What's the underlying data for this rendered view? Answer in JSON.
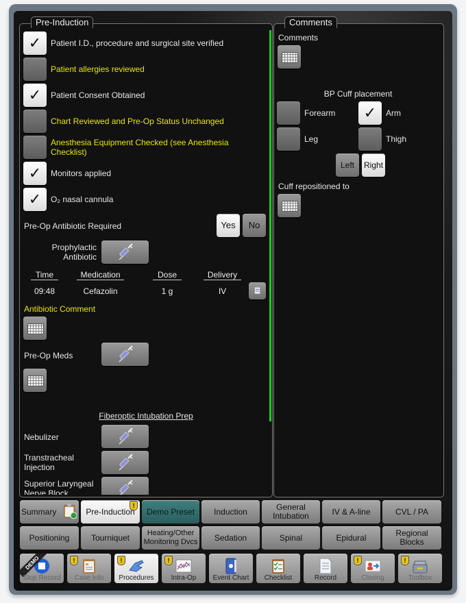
{
  "pre_induction": {
    "title": "Pre-Induction",
    "checklist": [
      {
        "label": "Patient I.D., procedure and surgical site verified",
        "checked": true,
        "highlight": false
      },
      {
        "label": "Patient allergies reviewed",
        "checked": false,
        "highlight": true
      },
      {
        "label": "Patient Consent Obtained",
        "checked": true,
        "highlight": false
      },
      {
        "label": "Chart Reviewed and Pre-Op Status Unchanged",
        "checked": false,
        "highlight": true
      },
      {
        "label": "Anesthesia Equipment Checked (see Anesthesia Checklist)",
        "checked": false,
        "highlight": true
      },
      {
        "label": "Monitors applied",
        "checked": true,
        "highlight": false
      },
      {
        "label": "O₂ nasal cannula",
        "checked": true,
        "highlight": false
      }
    ],
    "check_mark": "✓",
    "antibiotic_required_label": "Pre-Op Antibiotic Required",
    "yes_label": "Yes",
    "no_label": "No",
    "antibiotic_selected": "Yes",
    "prophylactic_label": "Prophylactic Antibiotic",
    "med_table": {
      "headers": [
        "Time",
        "Medication",
        "Dose",
        "Delivery"
      ],
      "rows": [
        [
          "09:48",
          "Cefazolin",
          "1 g",
          "IV"
        ]
      ]
    },
    "antibiotic_comment_label": "Antibiotic Comment",
    "preop_meds_label": "Pre-Op Meds",
    "fiberoptic_title": "Fiberoptic Intubation Prep",
    "fiberoptic_items": [
      "Nebulizer",
      "Transtracheal Injection",
      "Superior Laryngeal Nerve Block"
    ]
  },
  "comments": {
    "title": "Comments",
    "comments_label": "Comments",
    "bp_cuff_label": "BP Cuff placement",
    "cuff_options": [
      {
        "label": "Forearm",
        "checked": false
      },
      {
        "label": "Arm",
        "checked": true
      },
      {
        "label": "Leg",
        "checked": false
      },
      {
        "label": "Thigh",
        "checked": false
      }
    ],
    "left_label": "Left",
    "right_label": "Right",
    "side_selected": "Right",
    "cuff_repositioned_label": "Cuff repositioned to"
  },
  "nav_row1": [
    {
      "label": "Summary",
      "state": "normal"
    },
    {
      "label": "Pre-Induction",
      "state": "active",
      "warning": true
    },
    {
      "label": "Demo Preset",
      "state": "teal"
    },
    {
      "label": "Induction",
      "state": "normal"
    },
    {
      "label": "General Intubation",
      "state": "normal"
    },
    {
      "label": "IV & A-line",
      "state": "normal"
    },
    {
      "label": "CVL / PA",
      "state": "normal"
    }
  ],
  "nav_row2": [
    {
      "label": "Positioning"
    },
    {
      "label": "Tourniquet"
    },
    {
      "label": "Heating/Other Monitoring Dvcs"
    },
    {
      "label": "Sedation"
    },
    {
      "label": "Spinal"
    },
    {
      "label": "Epidural"
    },
    {
      "label": "Regional Blocks"
    }
  ],
  "toolbar": [
    {
      "label": "Stop Record",
      "icon": "stop-record-icon",
      "badge": "DEMO",
      "warning": false,
      "state": "dim"
    },
    {
      "label": "Case Info",
      "icon": "clipboard-icon",
      "warning": true,
      "state": "dim"
    },
    {
      "label": "Procedures",
      "icon": "glove-hand-icon",
      "warning": true,
      "state": "active"
    },
    {
      "label": "Intra-Op",
      "icon": "chart-icon",
      "warning": true,
      "state": "normal"
    },
    {
      "label": "Event Chart",
      "icon": "binder-icon",
      "warning": false,
      "state": "normal"
    },
    {
      "label": "Checklist",
      "icon": "checklist-icon",
      "warning": false,
      "state": "normal"
    },
    {
      "label": "Record",
      "icon": "document-icon",
      "warning": false,
      "state": "normal"
    },
    {
      "label": "Closing",
      "icon": "patient-transfer-icon",
      "warning": true,
      "state": "dim"
    },
    {
      "label": "Toolbox",
      "icon": "toolbox-icon",
      "warning": true,
      "state": "dim"
    }
  ],
  "warning_glyph": "!"
}
